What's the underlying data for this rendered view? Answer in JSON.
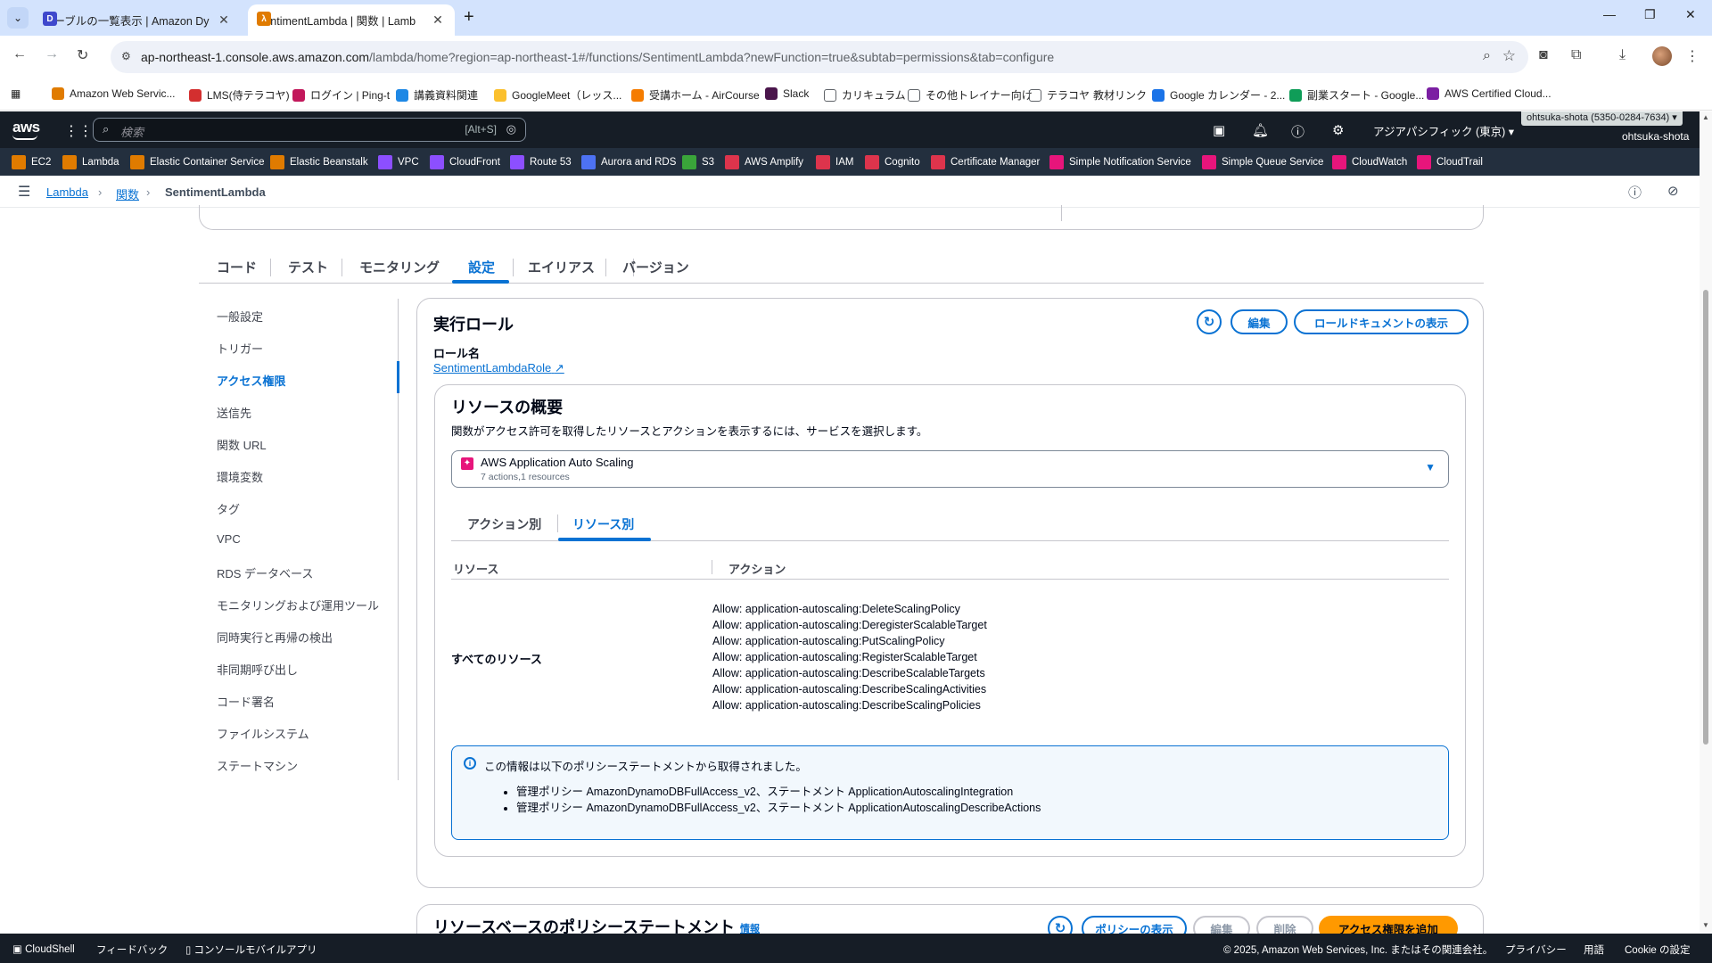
{
  "browser": {
    "tabs": [
      {
        "title": "テーブルの一覧表示 | Amazon Dy",
        "active": false,
        "favicon_color": "#3f48cc"
      },
      {
        "title": "SentimentLambda | 関数 | Lamb",
        "active": true,
        "favicon_color": "#e07b00"
      }
    ],
    "url_host": "ap-northeast-1.console.aws.amazon.com",
    "url_path": "/lambda/home?region=ap-northeast-1#/functions/SentimentLambda?newFunction=true&subtab=permissions&tab=configure",
    "bookmarks": [
      {
        "label": "Amazon Web Servic...",
        "color": "#e07b00"
      },
      {
        "label": "LMS(侍テラコヤ)",
        "color": "#d32f2f"
      },
      {
        "label": "ログイン | Ping-t",
        "color": "#c2185b"
      },
      {
        "label": "講義資料関連",
        "color": "#1e88e5"
      },
      {
        "label": "GoogleMeet（レッス...",
        "color": "#fbc02d"
      },
      {
        "label": "受講ホーム - AirCourse",
        "color": "#f57c00"
      },
      {
        "label": "Slack",
        "color": "#4a154b"
      },
      {
        "label": "カリキュラム",
        "color": "#5f6368"
      },
      {
        "label": "その他トレイナー向け",
        "color": "#5f6368"
      },
      {
        "label": "テラコヤ",
        "color": "#5f6368"
      },
      {
        "label": "教材リンク",
        "color": "#5f6368"
      },
      {
        "label": "Google カレンダー - 2...",
        "color": "#1a73e8"
      },
      {
        "label": "副業スタート - Google...",
        "color": "#0f9d58"
      },
      {
        "label": "AWS Certified Cloud...",
        "color": "#7b1fa2"
      }
    ]
  },
  "aws": {
    "logo": "aws",
    "search_placeholder": "検索",
    "search_shortcut": "[Alt+S]",
    "region": "アジアパシフィック (東京) ▾",
    "account_badge": "ohtsuka-shota (5350-0284-7634) ▾",
    "account_name": "ohtsuka-shota",
    "favorites": [
      {
        "label": "EC2",
        "color": "#e07b00"
      },
      {
        "label": "Lambda",
        "color": "#e07b00"
      },
      {
        "label": "Elastic Container Service",
        "color": "#e07b00"
      },
      {
        "label": "Elastic Beanstalk",
        "color": "#e07b00"
      },
      {
        "label": "VPC",
        "color": "#8c4fff"
      },
      {
        "label": "CloudFront",
        "color": "#8c4fff"
      },
      {
        "label": "Route 53",
        "color": "#8c4fff"
      },
      {
        "label": "Aurora and RDS",
        "color": "#4d72f3"
      },
      {
        "label": "S3",
        "color": "#3aa53a"
      },
      {
        "label": "AWS Amplify",
        "color": "#dd344c"
      },
      {
        "label": "IAM",
        "color": "#dd344c"
      },
      {
        "label": "Cognito",
        "color": "#dd344c"
      },
      {
        "label": "Certificate Manager",
        "color": "#dd344c"
      },
      {
        "label": "Simple Notification Service",
        "color": "#e7157b"
      },
      {
        "label": "Simple Queue Service",
        "color": "#e7157b"
      },
      {
        "label": "CloudWatch",
        "color": "#e7157b"
      },
      {
        "label": "CloudTrail",
        "color": "#e7157b"
      }
    ]
  },
  "breadcrumb": {
    "items": [
      "Lambda",
      "関数"
    ],
    "current": "SentimentLambda"
  },
  "tabs": [
    "コード",
    "テスト",
    "モニタリング",
    "設定",
    "エイリアス",
    "バージョン"
  ],
  "sidenav": [
    "一般設定",
    "トリガー",
    "アクセス権限",
    "送信先",
    "関数 URL",
    "環境変数",
    "タグ",
    "VPC",
    "RDS データベース",
    "モニタリングおよび運用ツール",
    "同時実行と再帰の検出",
    "非同期呼び出し",
    "コード署名",
    "ファイルシステム",
    "ステートマシン"
  ],
  "role": {
    "title": "実行ロール",
    "edit": "編集",
    "view_doc": "ロールドキュメントの表示",
    "name_label": "ロール名",
    "name": "SentimentLambdaRole"
  },
  "resources": {
    "title": "リソースの概要",
    "description": "関数がアクセス許可を取得したリソースとアクションを表示するには、サービスを選択します。",
    "service": "AWS Application Auto Scaling",
    "service_sub": "7 actions,1 resources",
    "subtabs": [
      "アクション別",
      "リソース別"
    ],
    "col_resource": "リソース",
    "col_action": "アクション",
    "resource": "すべてのリソース",
    "actions": [
      "Allow: application-autoscaling:DeleteScalingPolicy",
      "Allow: application-autoscaling:DeregisterScalableTarget",
      "Allow: application-autoscaling:PutScalingPolicy",
      "Allow: application-autoscaling:RegisterScalableTarget",
      "Allow: application-autoscaling:DescribeScalableTargets",
      "Allow: application-autoscaling:DescribeScalingActivities",
      "Allow: application-autoscaling:DescribeScalingPolicies"
    ],
    "info_title": "この情報は以下のポリシーステートメントから取得されました。",
    "info_items": [
      "管理ポリシー AmazonDynamoDBFullAccess_v2、ステートメント ApplicationAutoscalingIntegration",
      "管理ポリシー AmazonDynamoDBFullAccess_v2、ステートメント ApplicationAutoscalingDescribeActions"
    ]
  },
  "policy": {
    "title": "リソースベースのポリシーステートメント",
    "info": "情報",
    "view": "ポリシーの表示",
    "edit": "編集",
    "delete": "削除",
    "add": "アクセス権限を追加"
  },
  "footer": {
    "cloudshell": "CloudShell",
    "feedback": "フィードバック",
    "mobile": "コンソールモバイルアプリ",
    "copyright": "© 2025, Amazon Web Services, Inc. またはその関連会社。",
    "privacy": "プライバシー",
    "terms": "用語",
    "cookie": "Cookie の設定"
  }
}
